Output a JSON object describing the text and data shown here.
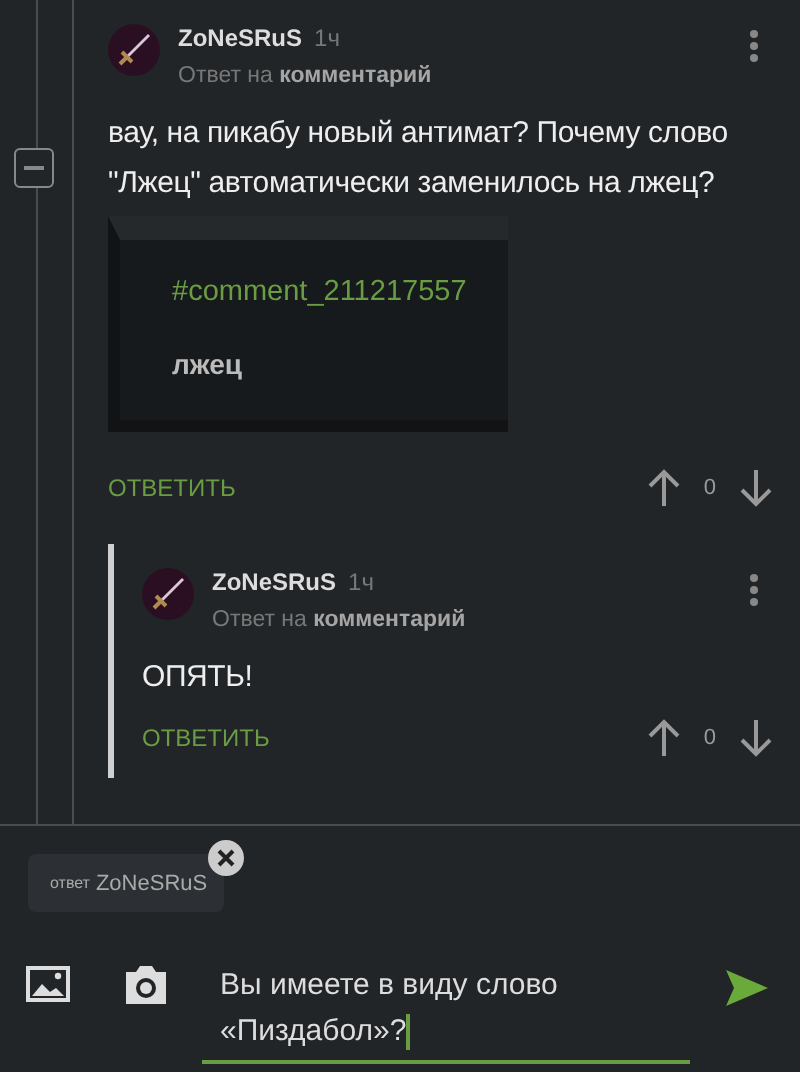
{
  "comments": [
    {
      "author": "ZoNeSRuS",
      "time": "1ч",
      "reply_prefix": "Ответ на",
      "reply_link": "комментарий",
      "text": "вау, на пикабу новый антимат? Почему слово \"Лжец\" автоматически заменилось на лжец?",
      "quote": {
        "link": "#comment_211217557",
        "text": "лжец"
      },
      "reply_button": "ОТВЕТИТЬ",
      "score": "0",
      "children": [
        {
          "author": "ZoNeSRuS",
          "time": "1ч",
          "reply_prefix": "Ответ на",
          "reply_link": "комментарий",
          "text": "ОПЯТЬ!",
          "reply_button": "ОТВЕТИТЬ",
          "score": "0"
        }
      ]
    }
  ],
  "reply_chip": {
    "prefix": "ответ",
    "name": "ZoNeSRuS"
  },
  "composer": {
    "value": "Вы имеете в виду слово «Пиздабол»?"
  }
}
